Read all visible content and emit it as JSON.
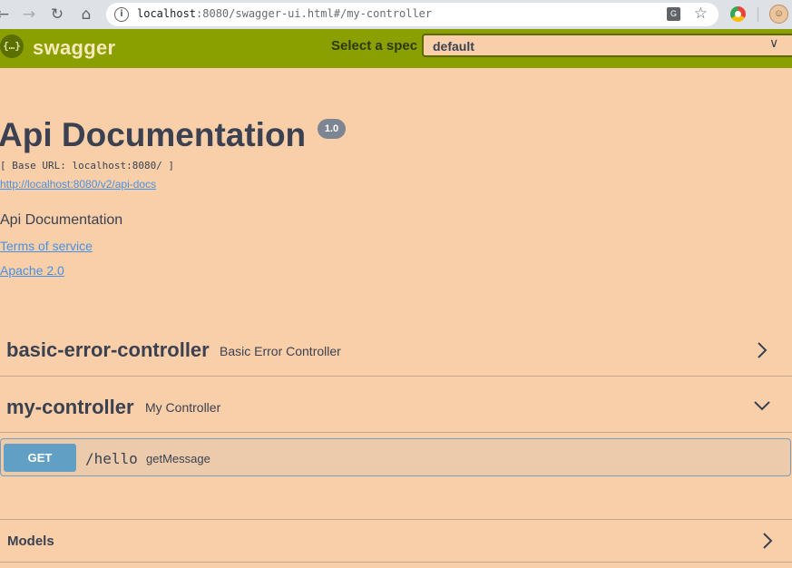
{
  "browser": {
    "url_host": "localhost",
    "url_rest": ":8080/swagger-ui.html#/my-controller",
    "back_glyph": "←",
    "forward_glyph": "→",
    "reload_glyph": "↻",
    "home_glyph": "⌂",
    "star_glyph": "☆",
    "icons": [
      "back-icon",
      "forward-icon",
      "reload-icon",
      "home-icon",
      "info-icon",
      "translate-icon",
      "star-icon",
      "extension-icon",
      "avatar-icon"
    ]
  },
  "topbar": {
    "logo_icon": "{…}",
    "logo_text": "swagger",
    "select_label": "Select a spec",
    "select_value": "default",
    "background": "#89a000"
  },
  "info": {
    "title": "Api Documentation",
    "version": "1.0",
    "base_url": "[ Base URL: localhost:8080/ ]",
    "docs_url": "http://localhost:8080/v2/api-docs",
    "description": "Api Documentation",
    "terms": "Terms of service",
    "license": "Apache 2.0"
  },
  "tags": [
    {
      "name": "basic-error-controller",
      "description": "Basic Error Controller",
      "expanded": false
    },
    {
      "name": "my-controller",
      "description": "My Controller",
      "expanded": true
    }
  ],
  "operations": [
    {
      "method": "GET",
      "path": "/hello",
      "summary": "getMessage",
      "color": "#61a0c4"
    }
  ],
  "models": {
    "label": "Models",
    "expanded": false
  },
  "colors": {
    "page_bg": "#f8cfa9",
    "text": "#3b4151",
    "link": "#4990e2"
  }
}
